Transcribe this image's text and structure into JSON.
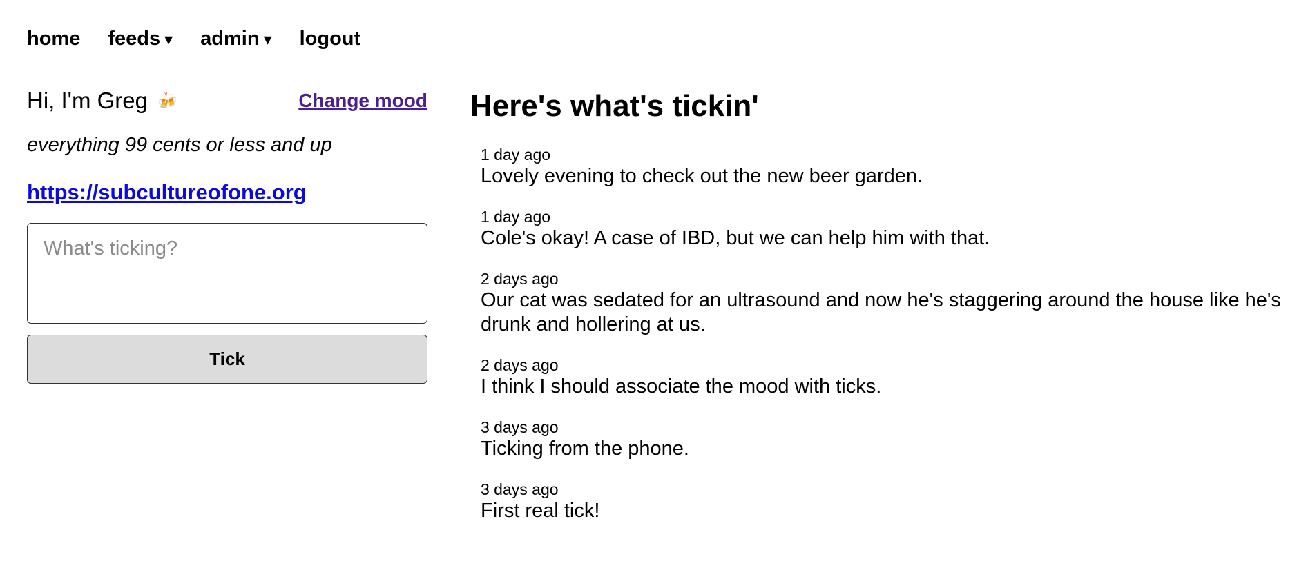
{
  "nav": {
    "home": "home",
    "feeds": "feeds",
    "admin": "admin",
    "logout": "logout",
    "caret": "▾"
  },
  "profile": {
    "greeting": "Hi, I'm Greg",
    "mood_icon": "beer-mug-icon",
    "mood_glyph": "🍻",
    "change_mood": "Change mood",
    "tagline": "everything 99 cents or less and up",
    "website": "https://subcultureofone.org"
  },
  "composer": {
    "placeholder": "What's ticking?",
    "button": "Tick"
  },
  "feed": {
    "title": "Here's what's tickin'",
    "ticks": [
      {
        "time": "1 day ago",
        "text": "Lovely evening to check out the new beer garden."
      },
      {
        "time": "1 day ago",
        "text": "Cole's okay! A case of IBD, but we can help him with that."
      },
      {
        "time": "2 days ago",
        "text": "Our cat was sedated for an ultrasound and now he's staggering around the house like he's drunk and hollering at us."
      },
      {
        "time": "2 days ago",
        "text": "I think I should associate the mood with ticks."
      },
      {
        "time": "3 days ago",
        "text": "Ticking from the phone."
      },
      {
        "time": "3 days ago",
        "text": "First real tick!"
      }
    ]
  },
  "colors": {
    "link_visited": "#4b1f8f",
    "link": "#0a0ade",
    "button_bg": "#dcdcdc",
    "border": "#333333"
  }
}
